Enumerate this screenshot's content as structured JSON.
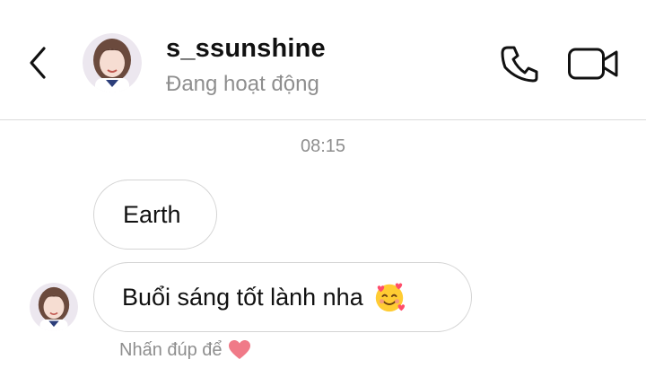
{
  "header": {
    "username": "s_ssunshine",
    "status": "Đang hoạt động",
    "icons": {
      "back": "chevron-left-icon",
      "call": "phone-icon",
      "video": "video-camera-icon"
    }
  },
  "conversation": {
    "timestamp": "08:15",
    "messages": [
      {
        "text": "Earth"
      },
      {
        "text": "Buổi sáng tốt lành nha",
        "emoji": "smiling-face-with-hearts"
      }
    ],
    "hint": "Nhấn đúp để",
    "hint_icon": "heart-icon"
  },
  "colors": {
    "text": "#111111",
    "muted": "#8e8e8e",
    "bubble_border": "#d4d4d4",
    "divider": "#dbdbdb",
    "heart": "#f07a88"
  }
}
